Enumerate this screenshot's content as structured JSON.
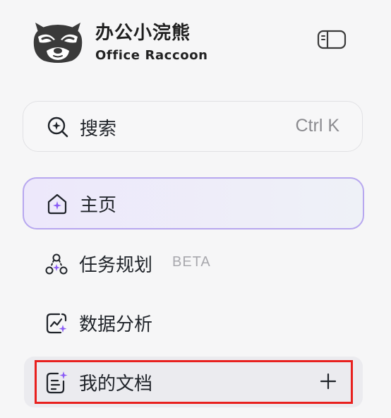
{
  "brand": {
    "title": "办公小浣熊",
    "subtitle": "Office Raccoon",
    "logo_icon": "raccoon-logo-icon"
  },
  "header": {
    "collapse_icon": "sidebar-toggle-icon"
  },
  "search": {
    "label": "搜索",
    "shortcut": "Ctrl K",
    "icon": "search-sparkle-icon"
  },
  "nav": {
    "items": [
      {
        "label": "主页",
        "icon": "home-sparkle-icon",
        "active": true
      },
      {
        "label": "任务规划",
        "icon": "task-planning-icon",
        "badge": "BETA"
      },
      {
        "label": "数据分析",
        "icon": "data-analysis-icon"
      },
      {
        "label": "我的文档",
        "icon": "document-sparkle-icon",
        "action_icon": "plus-icon",
        "highlighted": true
      }
    ]
  },
  "colors": {
    "accent": "#8b5cf6",
    "active_border": "#b7a7ef",
    "highlight": "#e8201e"
  }
}
